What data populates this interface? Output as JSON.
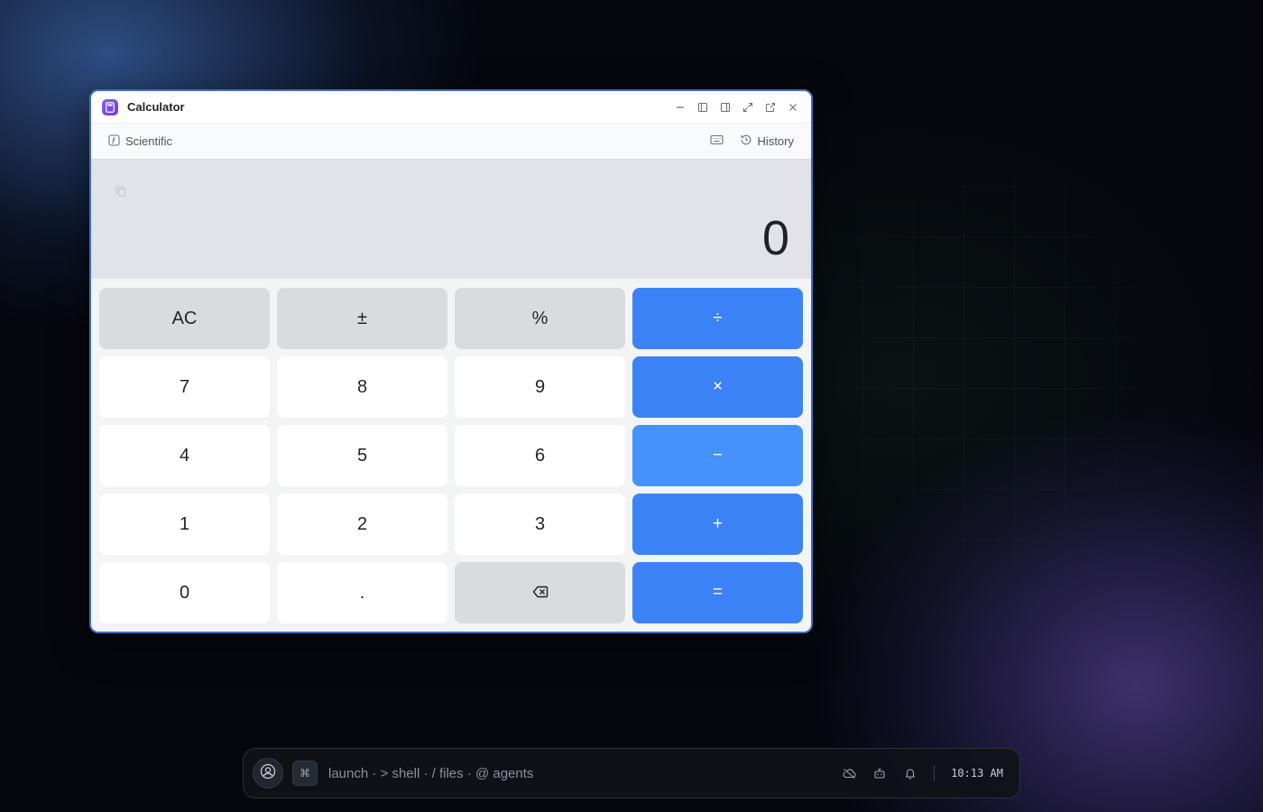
{
  "window": {
    "title": "Calculator",
    "accent_color": "#3d6fc4",
    "controls": [
      "minimize-icon",
      "sidebar-left-icon",
      "sidebar-right-icon",
      "expand-icon",
      "external-link-icon",
      "close-icon"
    ]
  },
  "toolbar": {
    "mode_label": "Scientific",
    "mode_icon": "function-icon",
    "keyboard_icon": "keyboard-icon",
    "history_label": "History",
    "history_icon": "history-icon"
  },
  "display": {
    "value": "0",
    "copy_icon": "copy-icon"
  },
  "keys": {
    "ac": "AC",
    "plus_minus": "±",
    "percent": "%",
    "divide": "÷",
    "seven": "7",
    "eight": "8",
    "nine": "9",
    "multiply": "×",
    "four": "4",
    "five": "5",
    "six": "6",
    "minus": "−",
    "one": "1",
    "two": "2",
    "three": "3",
    "plus": "+",
    "zero": "0",
    "decimal": ".",
    "backspace_icon": "backspace-icon",
    "equals": "=",
    "operator_color": "#3b82f6"
  },
  "taskbar": {
    "prompt": "launch · > shell · / files · @ agents",
    "cmd_key": "⌘",
    "time": "10:13 AM",
    "icons": [
      "user-icon",
      "cloud-off-icon",
      "bot-icon",
      "bell-icon"
    ]
  }
}
